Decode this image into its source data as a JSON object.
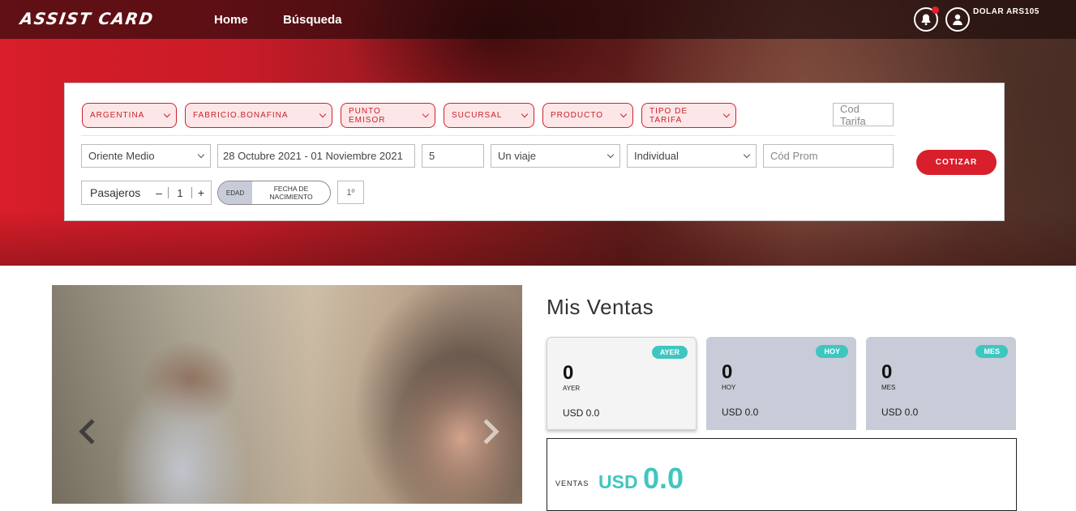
{
  "brand": {
    "logo_text": "ASSIST CARD"
  },
  "nav": {
    "items": [
      "Home",
      "Búsqueda"
    ]
  },
  "header": {
    "dolar_label": "DOLAR ARS105",
    "notification_icon": "bell-icon",
    "user_icon": "user-icon"
  },
  "colors": {
    "brand_red": "#d81f2b",
    "accent_teal": "#3fc6c0",
    "pill_bg": "#fde6e7",
    "card_gray": "#c7ccd8"
  },
  "search": {
    "pills": [
      {
        "label": "ARGENTINA"
      },
      {
        "label": "FABRICIO.BONAFINA"
      },
      {
        "label": "PUNTO EMISOR"
      },
      {
        "label": "SUCURSAL"
      },
      {
        "label": "PRODUCTO"
      },
      {
        "label": "TIPO DE TARIFA"
      }
    ],
    "cod_tarifa_placeholder": "Cod Tarifa",
    "destination": "Oriente Medio",
    "date_range": "28 Octubre 2021 - 01 Noviembre 2021",
    "days": "5",
    "trip_type": "Un viaje",
    "plan_type": "Individual",
    "promo_placeholder": "Cód Prom",
    "cotizar_label": "COTIZAR",
    "passengers": {
      "label": "Pasajeros",
      "minus": "–",
      "count": "1",
      "plus": "+"
    },
    "age_toggle": {
      "edad_label": "EDAD",
      "fecha_label": "FECHA DE NACIMIENTO"
    },
    "ordinal": "1º"
  },
  "sales": {
    "title": "Mis Ventas",
    "cards": [
      {
        "badge": "AYER",
        "value": "0",
        "label": "AYER",
        "amount": "USD 0.0"
      },
      {
        "badge": "HOY",
        "value": "0",
        "label": "HOY",
        "amount": "USD 0.0"
      },
      {
        "badge": "MES",
        "value": "0",
        "label": "MES",
        "amount": "USD 0.0"
      }
    ],
    "total": {
      "label": "VENTAS",
      "currency": "USD",
      "value": "0.0"
    }
  }
}
